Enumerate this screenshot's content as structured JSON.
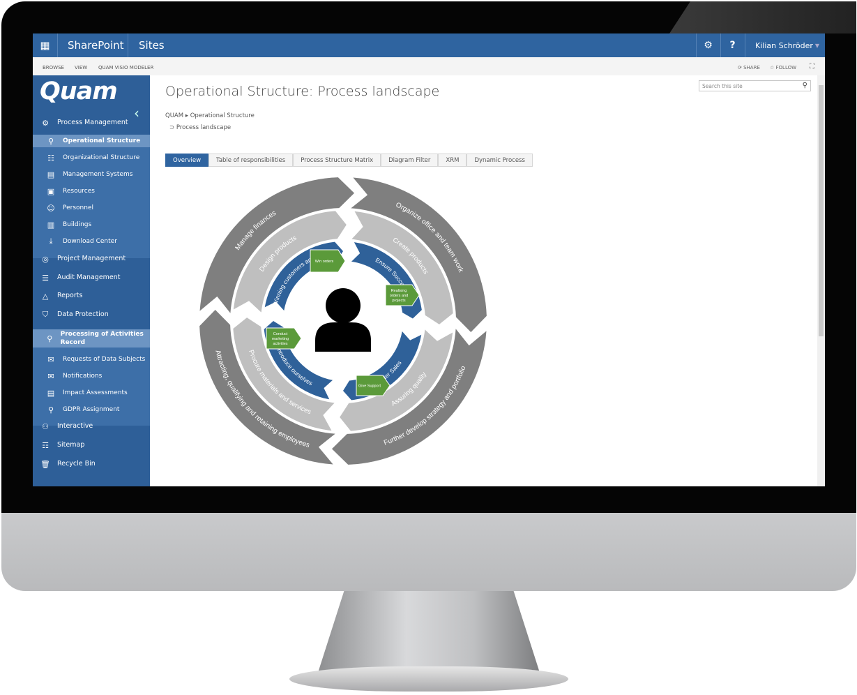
{
  "topbar": {
    "app": "SharePoint",
    "sites": "Sites",
    "settings_icon": "gear-icon",
    "help": "?",
    "user": "Kilian Schröder"
  },
  "ribbon": {
    "tabs": [
      "BROWSE",
      "VIEW",
      "QUAM VISIO MODELER"
    ],
    "share": "SHARE",
    "follow": "FOLLOW"
  },
  "sidebar": {
    "logo": "Quam",
    "items": [
      {
        "label": "Process Management",
        "level": "top",
        "icon": "gear-cluster-icon",
        "glyph": "⚙"
      },
      {
        "label": "Operational Structure",
        "level": "sub",
        "selected": true,
        "icon": "flow-icon",
        "glyph": "⚲"
      },
      {
        "label": "Organizational Structure",
        "level": "sub",
        "icon": "org-chart-icon",
        "glyph": "☷"
      },
      {
        "label": "Management Systems",
        "level": "sub",
        "icon": "document-icon",
        "glyph": "▤"
      },
      {
        "label": "Resources",
        "level": "sub",
        "icon": "resources-icon",
        "glyph": "▣"
      },
      {
        "label": "Personnel",
        "level": "sub",
        "icon": "people-icon",
        "glyph": "☺"
      },
      {
        "label": "Buildings",
        "level": "sub",
        "icon": "building-icon",
        "glyph": "▥"
      },
      {
        "label": "Download Center",
        "level": "sub",
        "icon": "download-icon",
        "glyph": "⤓"
      },
      {
        "label": "Project Management",
        "level": "top",
        "icon": "globe-icon",
        "glyph": "◎"
      },
      {
        "label": "Audit Management",
        "level": "top",
        "icon": "audit-icon",
        "glyph": "☰"
      },
      {
        "label": "Reports",
        "level": "top",
        "icon": "chart-icon",
        "glyph": "△"
      },
      {
        "label": "Data Protection",
        "level": "top",
        "icon": "shield-icon",
        "glyph": "⛉"
      },
      {
        "label": "Processing of Activities Record",
        "level": "sub",
        "selected": true,
        "icon": "flow-shield-icon",
        "glyph": "⚲"
      },
      {
        "label": "Requests of Data Subjects",
        "level": "sub",
        "icon": "mail-lock-icon",
        "glyph": "✉"
      },
      {
        "label": "Notifications",
        "level": "sub",
        "icon": "mail-shield-icon",
        "glyph": "✉"
      },
      {
        "label": "Impact Assessments",
        "level": "sub",
        "icon": "doc-lock-icon",
        "glyph": "▤"
      },
      {
        "label": "GDPR Assignment",
        "level": "sub",
        "icon": "flow-icon",
        "glyph": "⚲"
      },
      {
        "label": "Interactive",
        "level": "top",
        "icon": "interactive-icon",
        "glyph": "⚇"
      },
      {
        "label": "Sitemap",
        "level": "top",
        "icon": "sitemap-icon",
        "glyph": "☶"
      },
      {
        "label": "Recycle Bin",
        "level": "top",
        "icon": "trash-icon",
        "glyph": "🗑"
      }
    ]
  },
  "page": {
    "title": "Operational Structure: Process landscape",
    "breadcrumb": [
      "QUAM",
      "Operational Structure"
    ],
    "current": "Process landscape",
    "search_placeholder": "Search this site"
  },
  "tabs": [
    {
      "label": "Overview",
      "active": true
    },
    {
      "label": "Table of responsibilities"
    },
    {
      "label": "Process Structure Matrix"
    },
    {
      "label": "Diagram Filter"
    },
    {
      "label": "XRM"
    },
    {
      "label": "Dynamic Process"
    }
  ],
  "diagram": {
    "colors": {
      "outer": "#7f7f7f",
      "middle": "#bfbfbf",
      "inner": "#2f6199",
      "task": "#5b9a3a",
      "person": "#000000"
    },
    "outer": [
      "Manage finances",
      "Organize office and team work",
      "Further develop strategy and portfolio",
      "Attracting, qualifying and retaining employees"
    ],
    "middle": [
      "Design products",
      "Create products",
      "Assuring quality",
      "Procure materials and services"
    ],
    "inner": [
      "Winning customers and orders",
      "Ensure Succes",
      "After Sales",
      "Introduce ourselves"
    ],
    "tasks": [
      "Win orders",
      "Realising orders and projects",
      "Give Support",
      "Conduct marketing activities"
    ]
  }
}
